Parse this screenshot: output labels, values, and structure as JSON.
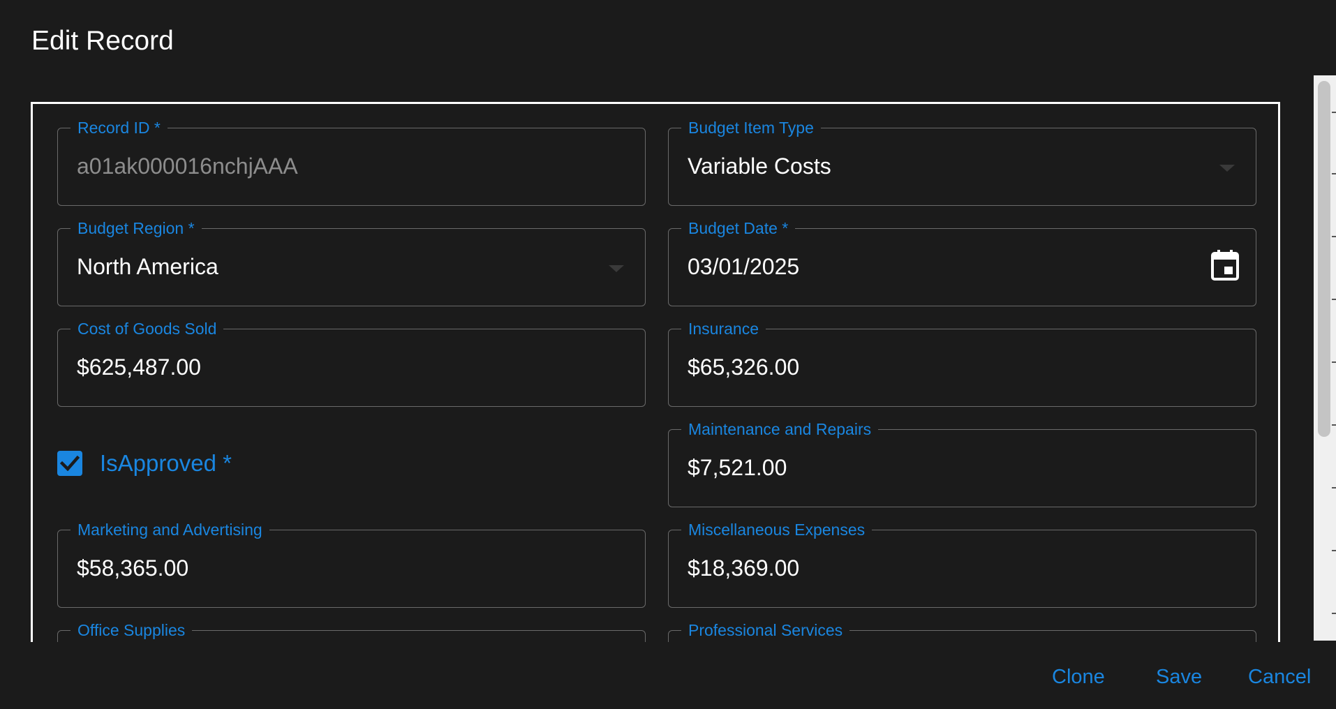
{
  "dialog": {
    "title": "Edit Record"
  },
  "fields": {
    "record_id": {
      "label": "Record ID *",
      "value": "a01ak000016nchjAAA"
    },
    "budget_item_type": {
      "label": "Budget Item Type",
      "value": "Variable Costs"
    },
    "budget_region": {
      "label": "Budget Region *",
      "value": "North America"
    },
    "budget_date": {
      "label": "Budget Date *",
      "value": "03/01/2025"
    },
    "cost_of_goods_sold": {
      "label": "Cost of Goods Sold",
      "value": "$625,487.00"
    },
    "insurance": {
      "label": "Insurance",
      "value": "$65,326.00"
    },
    "is_approved": {
      "label": "IsApproved *",
      "checked": true
    },
    "maintenance_and_repairs": {
      "label": "Maintenance and Repairs",
      "value": "$7,521.00"
    },
    "marketing_and_advertising": {
      "label": "Marketing and Advertising",
      "value": "$58,365.00"
    },
    "miscellaneous_expenses": {
      "label": "Miscellaneous Expenses",
      "value": "$18,369.00"
    },
    "office_supplies": {
      "label": "Office Supplies"
    },
    "professional_services": {
      "label": "Professional Services"
    }
  },
  "icons": {
    "dropdown": "chevron-down-icon",
    "calendar": "calendar-icon",
    "checkbox": "check-icon"
  },
  "footer": {
    "clone_label": "Clone",
    "save_label": "Save",
    "cancel_label": "Cancel"
  },
  "colors": {
    "accent": "#1a86e0",
    "background": "#1b1b1b",
    "border": "#6a6a6a"
  }
}
